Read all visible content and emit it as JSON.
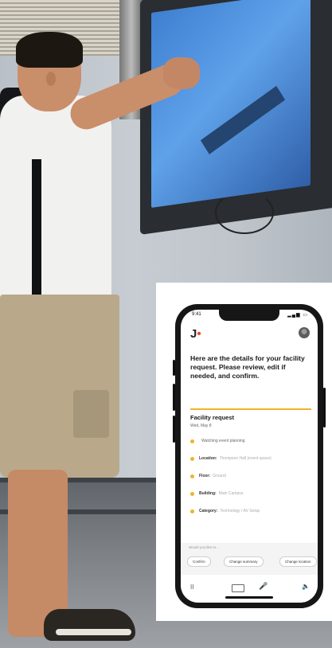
{
  "status_bar": {
    "time": "9:41",
    "icons": "▂▄▆ ▭"
  },
  "app": {
    "logo": "J",
    "prompt": "Here are the details for your facility request. Please review, edit if needed, and confirm."
  },
  "card": {
    "title": "Facility request",
    "subtitle": "Wed, May 8",
    "fields": [
      {
        "key": "",
        "value": "Watching event planning"
      },
      {
        "key": "Location:",
        "value": "Thompson Hall (event space)"
      },
      {
        "key": "Floor:",
        "value": "Ground"
      },
      {
        "key": "Building:",
        "value": "Main Campus"
      },
      {
        "key": "Category:",
        "value": "Technology / AV Setup"
      }
    ]
  },
  "suggestions": {
    "label": "Would you like to...",
    "chips": [
      "Confirm",
      "Change summary",
      "Change location"
    ]
  },
  "bottom_bar": {
    "icons": [
      "pause-icon",
      "keyboard-icon",
      "mic-icon",
      "speaker-icon"
    ],
    "pause": "II",
    "mic": "🎤",
    "speaker": "🔈"
  },
  "colors": {
    "accent": "#f0b429",
    "logo_dot": "#e7492e",
    "link": "#3a8fd9"
  }
}
